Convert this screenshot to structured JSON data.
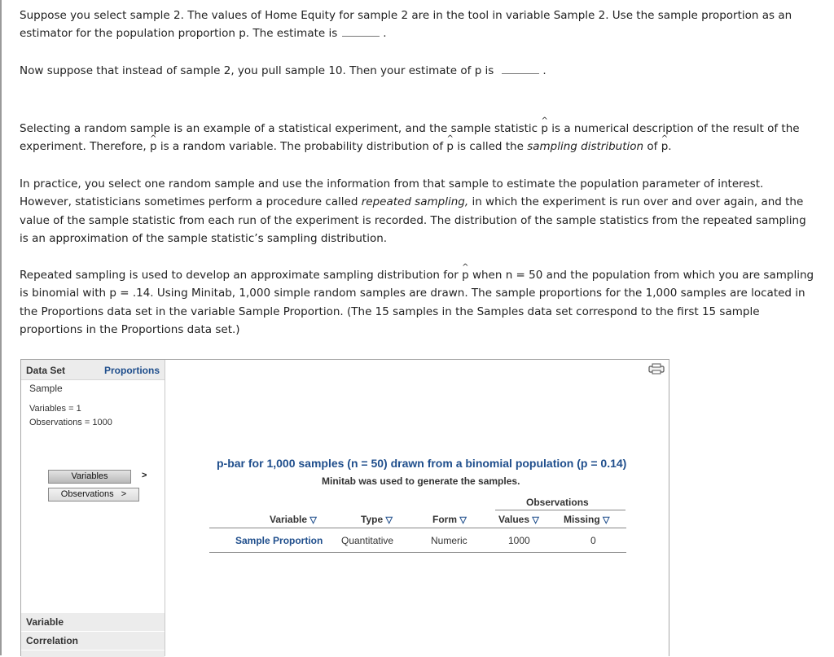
{
  "q1": {
    "a": "Suppose you select sample 2. The values of Home Equity for sample 2 are in the tool in variable Sample 2. Use the sample proportion as an estimator for the population proportion p. The estimate is",
    "end": "."
  },
  "q2": {
    "a": "Now suppose that instead of sample 2, you pull sample 10. Then your estimate of p is",
    "end": "."
  },
  "p3": {
    "a": "Selecting a random sample is an example of a statistical experiment, and the sample statistic",
    "b": "is a numerical description of the result of the experiment. Therefore,",
    "c": "is a random variable. The probability distribution of",
    "d": "is called the",
    "e": "sampling distribution",
    "f": "of",
    "g": "."
  },
  "p4": {
    "a": "In practice, you select one random sample and use the information from that sample to estimate the population parameter of interest. However, statisticians sometimes perform a procedure called",
    "b": "repeated sampling,",
    "c": "in which the experiment is run over and over again, and the value of the sample statistic from each run of the experiment is recorded. The distribution of the sample statistics from the repeated sampling is an approximation of the sample statistic’s sampling distribution."
  },
  "p5": {
    "a": "Repeated sampling is used to develop an approximate sampling distribution for",
    "b": "when n = 50 and the population from which you are sampling is binomial with p = .14. Using Minitab, 1,000 simple random samples are drawn. The sample proportions for the 1,000 samples are located in the Proportions data set in the variable Sample Proportion. (The 15 samples in the Samples data set correspond to the first 15 sample proportions in the Proportions data set.)"
  },
  "phat": "p",
  "tool": {
    "dataset_label": "Data Set",
    "dataset_value": "Proportions",
    "sample": "Sample",
    "variables_count": "Variables = 1",
    "observations_count": "Observations = 1000",
    "variables_btn": "Variables",
    "observations_btn": "Observations",
    "chevron": ">",
    "footer": [
      "Variable",
      "Correlation"
    ],
    "title": "p-bar for 1,000 samples (n = 50) drawn from a binomial population (p = 0.14)",
    "subtitle": "Minitab was used to generate the samples.",
    "group_header": "Observations",
    "columns": [
      "Variable",
      "Type",
      "Form",
      "Values",
      "Missing"
    ],
    "row": [
      "Sample Proportion",
      "Quantitative",
      "Numeric",
      "1000",
      "0"
    ],
    "sort_glyph": "▽"
  },
  "colors": {
    "link": "#1f4e8c",
    "panel": "#ececec"
  }
}
